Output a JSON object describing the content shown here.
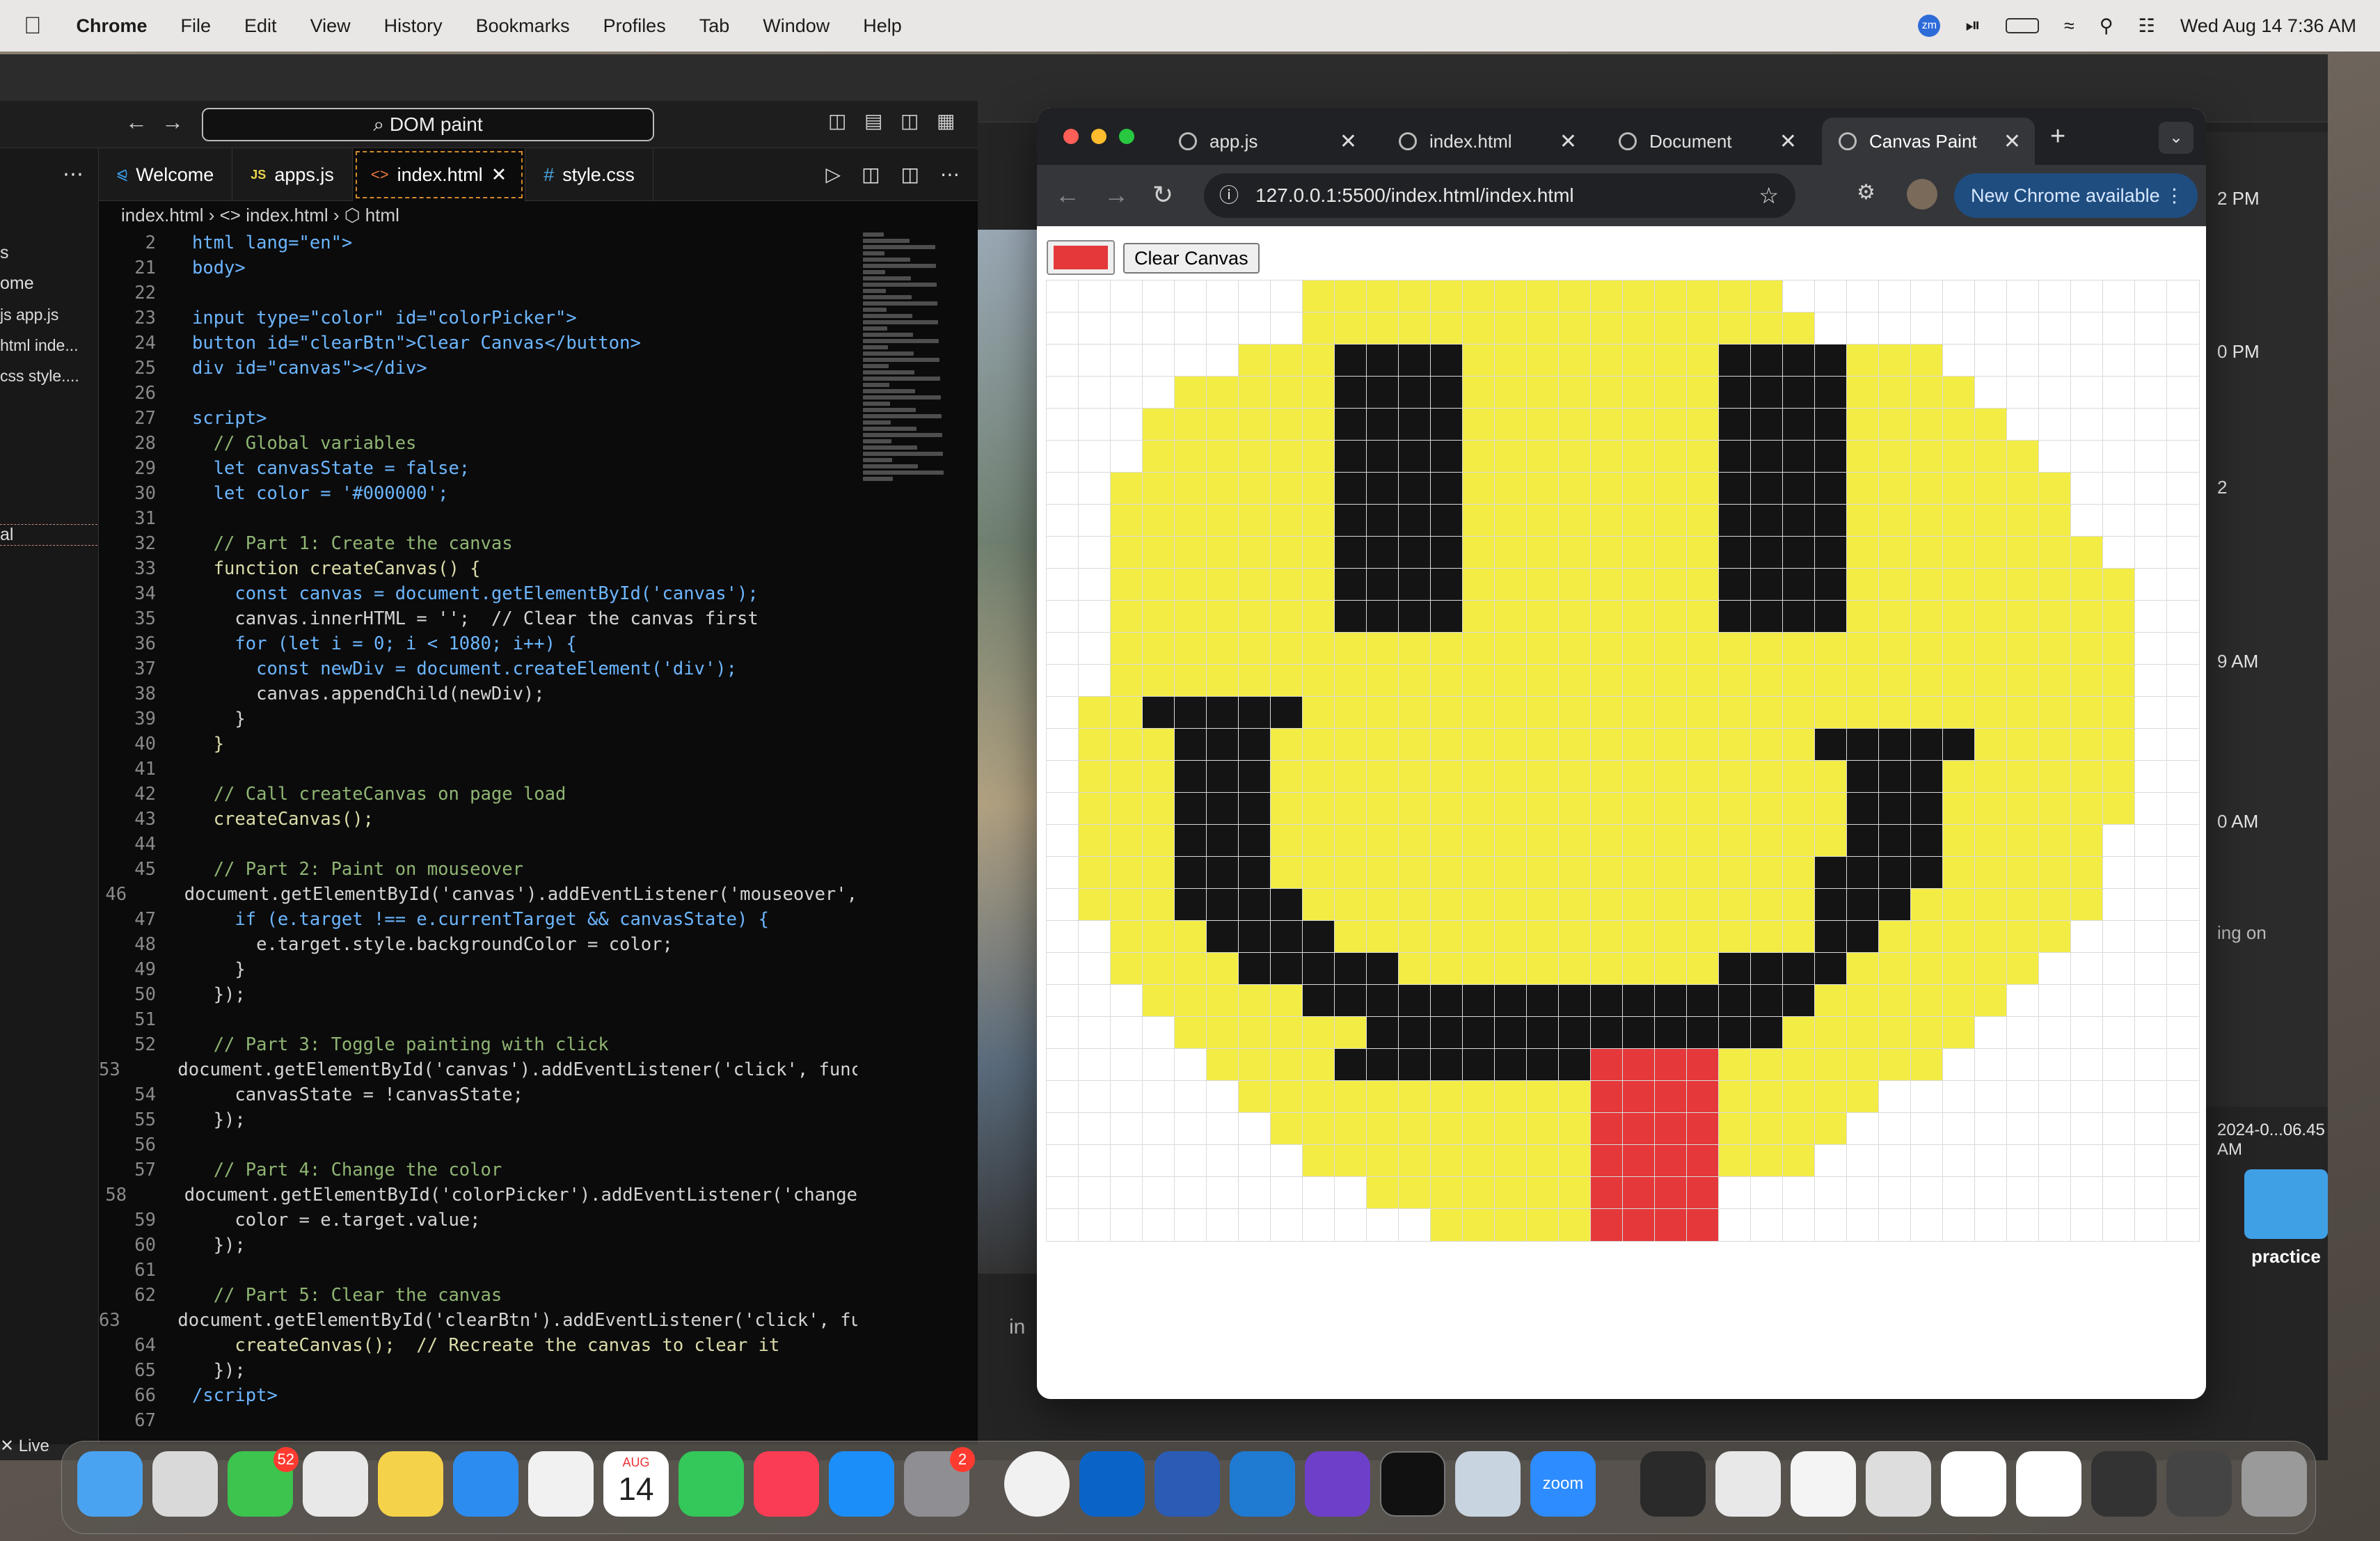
{
  "menubar": {
    "app": "Chrome",
    "items": [
      "File",
      "Edit",
      "View",
      "History",
      "Bookmarks",
      "Profiles",
      "Tab",
      "Window",
      "Help"
    ],
    "datetime": "Wed Aug 14  7:36 AM",
    "zoom_label": "zm"
  },
  "vscode": {
    "search": "DOM paint",
    "sidebar_items": [
      "s",
      "ome",
      "js app.js",
      "html inde...",
      "css style....",
      "al"
    ],
    "live_label": "Live",
    "tabs": [
      {
        "icon": "vscode-icon",
        "label": "Welcome"
      },
      {
        "icon": "js-icon",
        "label": "apps.js",
        "prefix": "JS"
      },
      {
        "icon": "html-icon",
        "label": "index.html",
        "prefix": "<>"
      },
      {
        "icon": "css-icon",
        "label": "style.css",
        "prefix": "#"
      }
    ],
    "breadcrumb": "index.html  ›  <>  index.html  ›  ⬡ html",
    "lines": [
      {
        "n": "2",
        "t": "html lang=\"en\">",
        "c": "kw"
      },
      {
        "n": "21",
        "t": "body>",
        "c": "kw"
      },
      {
        "n": "22",
        "t": "",
        "c": "pu"
      },
      {
        "n": "23",
        "t": "input type=\"color\" id=\"colorPicker\">",
        "c": "kw"
      },
      {
        "n": "24",
        "t": "button id=\"clearBtn\">Clear Canvas</button>",
        "c": "kw"
      },
      {
        "n": "25",
        "t": "div id=\"canvas\"></div>",
        "c": "kw"
      },
      {
        "n": "26",
        "t": "",
        "c": "pu"
      },
      {
        "n": "27",
        "t": "script>",
        "c": "kw"
      },
      {
        "n": "28",
        "t": "  // Global variables",
        "c": "cm"
      },
      {
        "n": "29",
        "t": "  let canvasState = false;",
        "c": "kw"
      },
      {
        "n": "30",
        "t": "  let color = '#000000';",
        "c": "kw"
      },
      {
        "n": "31",
        "t": "",
        "c": "pu"
      },
      {
        "n": "32",
        "t": "  // Part 1: Create the canvas",
        "c": "cm"
      },
      {
        "n": "33",
        "t": "  function createCanvas() {",
        "c": "fn"
      },
      {
        "n": "34",
        "t": "    const canvas = document.getElementById('canvas');",
        "c": "kw"
      },
      {
        "n": "35",
        "t": "    canvas.innerHTML = '';  // Clear the canvas first",
        "c": "pu"
      },
      {
        "n": "36",
        "t": "    for (let i = 0; i < 1080; i++) {",
        "c": "kw"
      },
      {
        "n": "37",
        "t": "      const newDiv = document.createElement('div');",
        "c": "kw"
      },
      {
        "n": "38",
        "t": "      canvas.appendChild(newDiv);",
        "c": "pu"
      },
      {
        "n": "39",
        "t": "    }",
        "c": "pu"
      },
      {
        "n": "40",
        "t": "  }",
        "c": "fn"
      },
      {
        "n": "41",
        "t": "",
        "c": "pu"
      },
      {
        "n": "42",
        "t": "  // Call createCanvas on page load",
        "c": "cm"
      },
      {
        "n": "43",
        "t": "  createCanvas();",
        "c": "fn"
      },
      {
        "n": "44",
        "t": "",
        "c": "pu"
      },
      {
        "n": "45",
        "t": "  // Part 2: Paint on mouseover",
        "c": "cm"
      },
      {
        "n": "46",
        "t": "  document.getElementById('canvas').addEventListener('mouseover',",
        "c": "pu"
      },
      {
        "n": "47",
        "t": "    if (e.target !== e.currentTarget && canvasState) {",
        "c": "kw"
      },
      {
        "n": "48",
        "t": "      e.target.style.backgroundColor = color;",
        "c": "pu"
      },
      {
        "n": "49",
        "t": "    }",
        "c": "pu"
      },
      {
        "n": "50",
        "t": "  });",
        "c": "pu"
      },
      {
        "n": "51",
        "t": "",
        "c": "pu"
      },
      {
        "n": "52",
        "t": "  // Part 3: Toggle painting with click",
        "c": "cm"
      },
      {
        "n": "53",
        "t": "  document.getElementById('canvas').addEventListener('click', func",
        "c": "pu"
      },
      {
        "n": "54",
        "t": "    canvasState = !canvasState;",
        "c": "pu"
      },
      {
        "n": "55",
        "t": "  });",
        "c": "pu"
      },
      {
        "n": "56",
        "t": "",
        "c": "pu"
      },
      {
        "n": "57",
        "t": "  // Part 4: Change the color",
        "c": "cm"
      },
      {
        "n": "58",
        "t": "  document.getElementById('colorPicker').addEventListener('change",
        "c": "pu"
      },
      {
        "n": "59",
        "t": "    color = e.target.value;",
        "c": "pu"
      },
      {
        "n": "60",
        "t": "  });",
        "c": "pu"
      },
      {
        "n": "61",
        "t": "",
        "c": "pu"
      },
      {
        "n": "62",
        "t": "  // Part 5: Clear the canvas",
        "c": "cm"
      },
      {
        "n": "63",
        "t": "  document.getElementById('clearBtn').addEventListener('click', fu",
        "c": "pu"
      },
      {
        "n": "64",
        "t": "    createCanvas();  // Recreate the canvas to clear it",
        "c": "fn"
      },
      {
        "n": "65",
        "t": "  });",
        "c": "pu"
      },
      {
        "n": "66",
        "t": "/script>",
        "c": "kw"
      },
      {
        "n": "67",
        "t": "",
        "c": "pu"
      }
    ]
  },
  "chrome": {
    "tabs": [
      {
        "label": "app.js",
        "active": false
      },
      {
        "label": "index.html",
        "active": false
      },
      {
        "label": "Document",
        "active": false
      },
      {
        "label": "Canvas Paint",
        "active": true
      }
    ],
    "url": "127.0.0.1:5500/index.html/index.html",
    "update_label": "New Chrome available",
    "clear_button": "Clear Canvas",
    "picker_color": "#e5383b"
  },
  "canvas": {
    "cols": 36,
    "colors": {
      "y": "#f2ec45",
      "k": "#141414",
      "r": "#e5383b"
    },
    "rows": [
      "........yyyyyyyyyyyyyyy.............",
      "....... yyyyyyyyyyyyyyyy............",
      "......yyykkkkyyyyyyyykkkkyyy........",
      "....yyyyykkkkyyyyyyyykkkkyyyy.......",
      "...yyyyyykkkkyyyyyyyykkkkyyyyy......",
      "...yyyyyykkkkyyyyyyyykkkkyyyyyy.....",
      "..yyyyyyykkkkyyyyyyyykkkkyyyyyyy....",
      "..yyyyyyykkkkyyyyyyyykkkkyyyyyyy....",
      "..yyyyyyykkkkyyyyyyyykkkkyyyyyyyy...",
      "..yyyyyyykkkkyyyyyyyykkkkyyyyyyyyy..",
      "..yyyyyyykkkkyyyyyyyykkkkyyyyyyyyy..",
      "..yyyyyyyyyyyyyyyyyyyyyyyyyyyyyyyy..",
      "..yyyyyyyyyyyyyyyyyyyyyyyyyyyyyyyy..",
      ".yykkkkkyyyyyyyyyyyyyyyyyyyyyyyyyy..",
      ".yyykkkyyyyyyyyyyyyyyyyykkkkkyyyyy..",
      ".yyykkkyyyyyyyyyyyyyyyyyykkkyyyyyy..",
      ".yyykkkyyyyyyyyyyyyyyyyyykkkyyyyyy..",
      ".yyykkkyyyyyyyyyyyyyyyyyykkkyyyyy...",
      ".yyykkkyyyyyyyyyyyyyyyyykkkkyyyyy...",
      ".yyykkkkyyyyyyyyyyyyyyyykkkyyyyyy...",
      "..yyykkkkyyyyyyyyyyyyyyykkyyyyyy....",
      "..yyyykkkkkyyyyyyyyyykkkkyyyyyy.....",
      "...yyyyykkkkkkkkkkkkkkkkyyyyyy......",
      "....yyyyyykkkkkkkkkkkkkyyyyyy.......",
      ".....yyyykkkkkkkkrrrryyyyyyy........",
      "......yyyyyyyyyyyrrrryyyyy..........",
      ".......yyyyyyyyyyrrrryyyy...........",
      "........yyyyyyyyyrrrryyy............",
      "..........yyyyyyyrrrr...............",
      "............yyyyyrrrr..............."
    ]
  },
  "desktop": {
    "folder_label": "practice",
    "bg_panel_times": [
      "2 PM",
      "0 PM",
      "2",
      "9 AM",
      "0 AM",
      "2024-0...06.45 AM"
    ],
    "bg_panel_text": "ing on",
    "bg_input_text": "in"
  },
  "dock": {
    "messages_badge": "52",
    "settings_badge": "2",
    "calendar_month": "AUG",
    "calendar_day": "14",
    "zoom_label": "zoom"
  }
}
